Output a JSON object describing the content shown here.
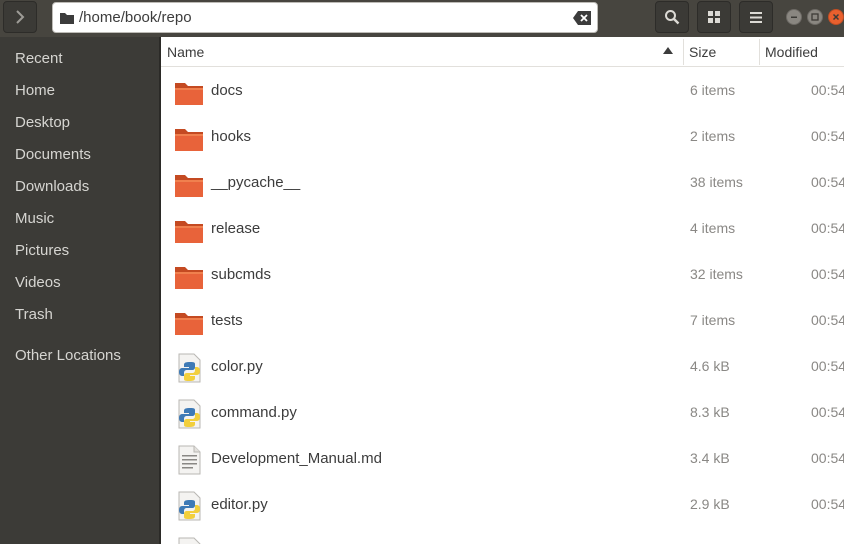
{
  "header": {
    "path": "/home/book/repo",
    "icons": {
      "back": "chevron-right-icon",
      "search": "search-icon",
      "view": "grid-view-icon",
      "menu": "hamburger-menu-icon",
      "clear": "clear-text-icon"
    }
  },
  "sidebar": {
    "items": [
      {
        "label": "Recent"
      },
      {
        "label": "Home"
      },
      {
        "label": "Desktop"
      },
      {
        "label": "Documents"
      },
      {
        "label": "Downloads"
      },
      {
        "label": "Music"
      },
      {
        "label": "Pictures"
      },
      {
        "label": "Videos"
      },
      {
        "label": "Trash"
      },
      {
        "label": "Other Locations"
      }
    ]
  },
  "columns": {
    "name": "Name",
    "size": "Size",
    "modified": "Modified"
  },
  "files": [
    {
      "name": "docs",
      "size": "6 items",
      "modified": "00:54",
      "type": "folder"
    },
    {
      "name": "hooks",
      "size": "2 items",
      "modified": "00:54",
      "type": "folder"
    },
    {
      "name": "__pycache__",
      "size": "38 items",
      "modified": "00:54",
      "type": "folder"
    },
    {
      "name": "release",
      "size": "4 items",
      "modified": "00:54",
      "type": "folder"
    },
    {
      "name": "subcmds",
      "size": "32 items",
      "modified": "00:54",
      "type": "folder"
    },
    {
      "name": "tests",
      "size": "7 items",
      "modified": "00:54",
      "type": "folder"
    },
    {
      "name": "color.py",
      "size": "4.6 kB",
      "modified": "00:54",
      "type": "python"
    },
    {
      "name": "command.py",
      "size": "8.3 kB",
      "modified": "00:54",
      "type": "python"
    },
    {
      "name": "Development_Manual.md",
      "size": "3.4 kB",
      "modified": "00:54",
      "type": "text"
    },
    {
      "name": "editor.py",
      "size": "2.9 kB",
      "modified": "00:54",
      "type": "python"
    }
  ],
  "colors": {
    "accent": "#e9602e",
    "folder": "#e8633a",
    "sidebar": "#3c3b37",
    "header": "#47453f"
  }
}
